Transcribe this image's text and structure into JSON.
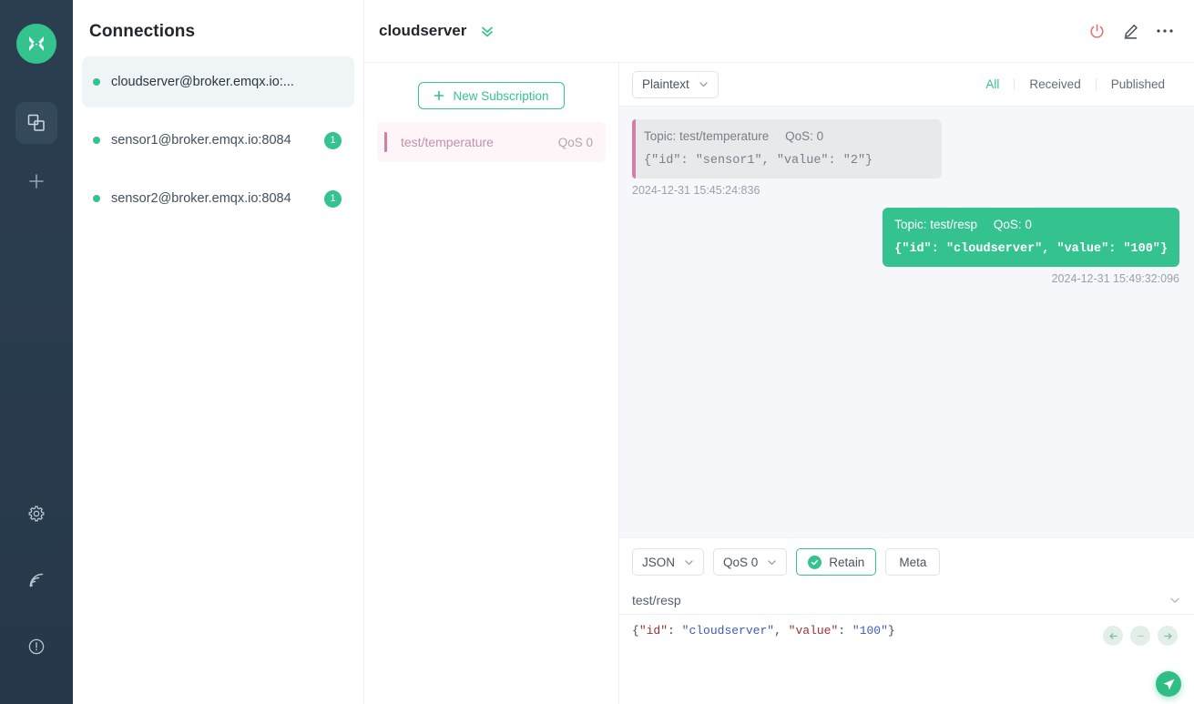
{
  "rail": {
    "logo_icon": "mqttx-logo-icon",
    "items": [
      {
        "icon": "connections-icon",
        "name": "connections",
        "active": true
      },
      {
        "icon": "plus-icon",
        "name": "new-connection",
        "active": false
      }
    ],
    "bottom_items": [
      {
        "icon": "gear-icon",
        "name": "settings"
      },
      {
        "icon": "broadcast-icon",
        "name": "log"
      },
      {
        "icon": "info-circle-icon",
        "name": "about"
      }
    ]
  },
  "connections": {
    "title": "Connections",
    "items": [
      {
        "name": "cloudserver@broker.emqx.io:...",
        "status": "connected",
        "badge": "",
        "selected": true
      },
      {
        "name": "sensor1@broker.emqx.io:8084",
        "status": "connected",
        "badge": "1",
        "selected": false
      },
      {
        "name": "sensor2@broker.emqx.io:8084",
        "status": "connected",
        "badge": "1",
        "selected": false
      }
    ]
  },
  "topbar": {
    "title": "cloudserver",
    "expand_icon": "double-chevron-down-icon",
    "actions": [
      {
        "icon": "power-icon",
        "name": "disconnect"
      },
      {
        "icon": "pencil-icon",
        "name": "edit-connection"
      },
      {
        "icon": "ellipsis-icon",
        "name": "more-options"
      }
    ]
  },
  "subscriptions": {
    "new_button": "New Subscription",
    "new_button_icon": "plus-icon",
    "items": [
      {
        "topic": "test/temperature",
        "qos": "QoS 0",
        "color": "#d17fa4"
      }
    ]
  },
  "messages": {
    "format_select": "Plaintext",
    "filters": [
      {
        "label": "All",
        "active": true
      },
      {
        "label": "Received",
        "active": false
      },
      {
        "label": "Published",
        "active": false
      }
    ],
    "list": [
      {
        "direction": "received",
        "topic_label": "Topic: test/temperature",
        "qos_label": "QoS: 0",
        "payload": "{\"id\": \"sensor1\", \"value\": \"2\"}",
        "timestamp": "2024-12-31 15:45:24:836"
      },
      {
        "direction": "published",
        "topic_label": "Topic: test/resp",
        "qos_label": "QoS: 0",
        "payload": "{\"id\": \"cloudserver\", \"value\": \"100\"}",
        "timestamp": "2024-12-31 15:49:32:096"
      }
    ]
  },
  "composer": {
    "payload_format": "JSON",
    "qos": "QoS 0",
    "retain_label": "Retain",
    "retain_checked": true,
    "meta_label": "Meta",
    "topic": "test/resp",
    "payload": "{\"id\": \"cloudserver\", \"value\": \"100\"}",
    "payload_tokens": [
      {
        "t": "{",
        "c": "p"
      },
      {
        "t": "\"id\"",
        "c": "k"
      },
      {
        "t": ": ",
        "c": "p"
      },
      {
        "t": "\"cloudserver\"",
        "c": "s"
      },
      {
        "t": ", ",
        "c": "p"
      },
      {
        "t": "\"value\"",
        "c": "k"
      },
      {
        "t": ": ",
        "c": "p"
      },
      {
        "t": "\"100\"",
        "c": "s"
      },
      {
        "t": "}",
        "c": "p"
      }
    ],
    "nav_back_icon": "arrow-left-icon",
    "nav_minus_icon": "minus-icon",
    "nav_forward_icon": "arrow-right-icon",
    "send_icon": "send-plane-icon"
  },
  "colors": {
    "accent_green": "#34c38f",
    "rail_bg": "#26394b",
    "subscription_pink": "#d17fa4",
    "power_red": "#f06a6a"
  }
}
